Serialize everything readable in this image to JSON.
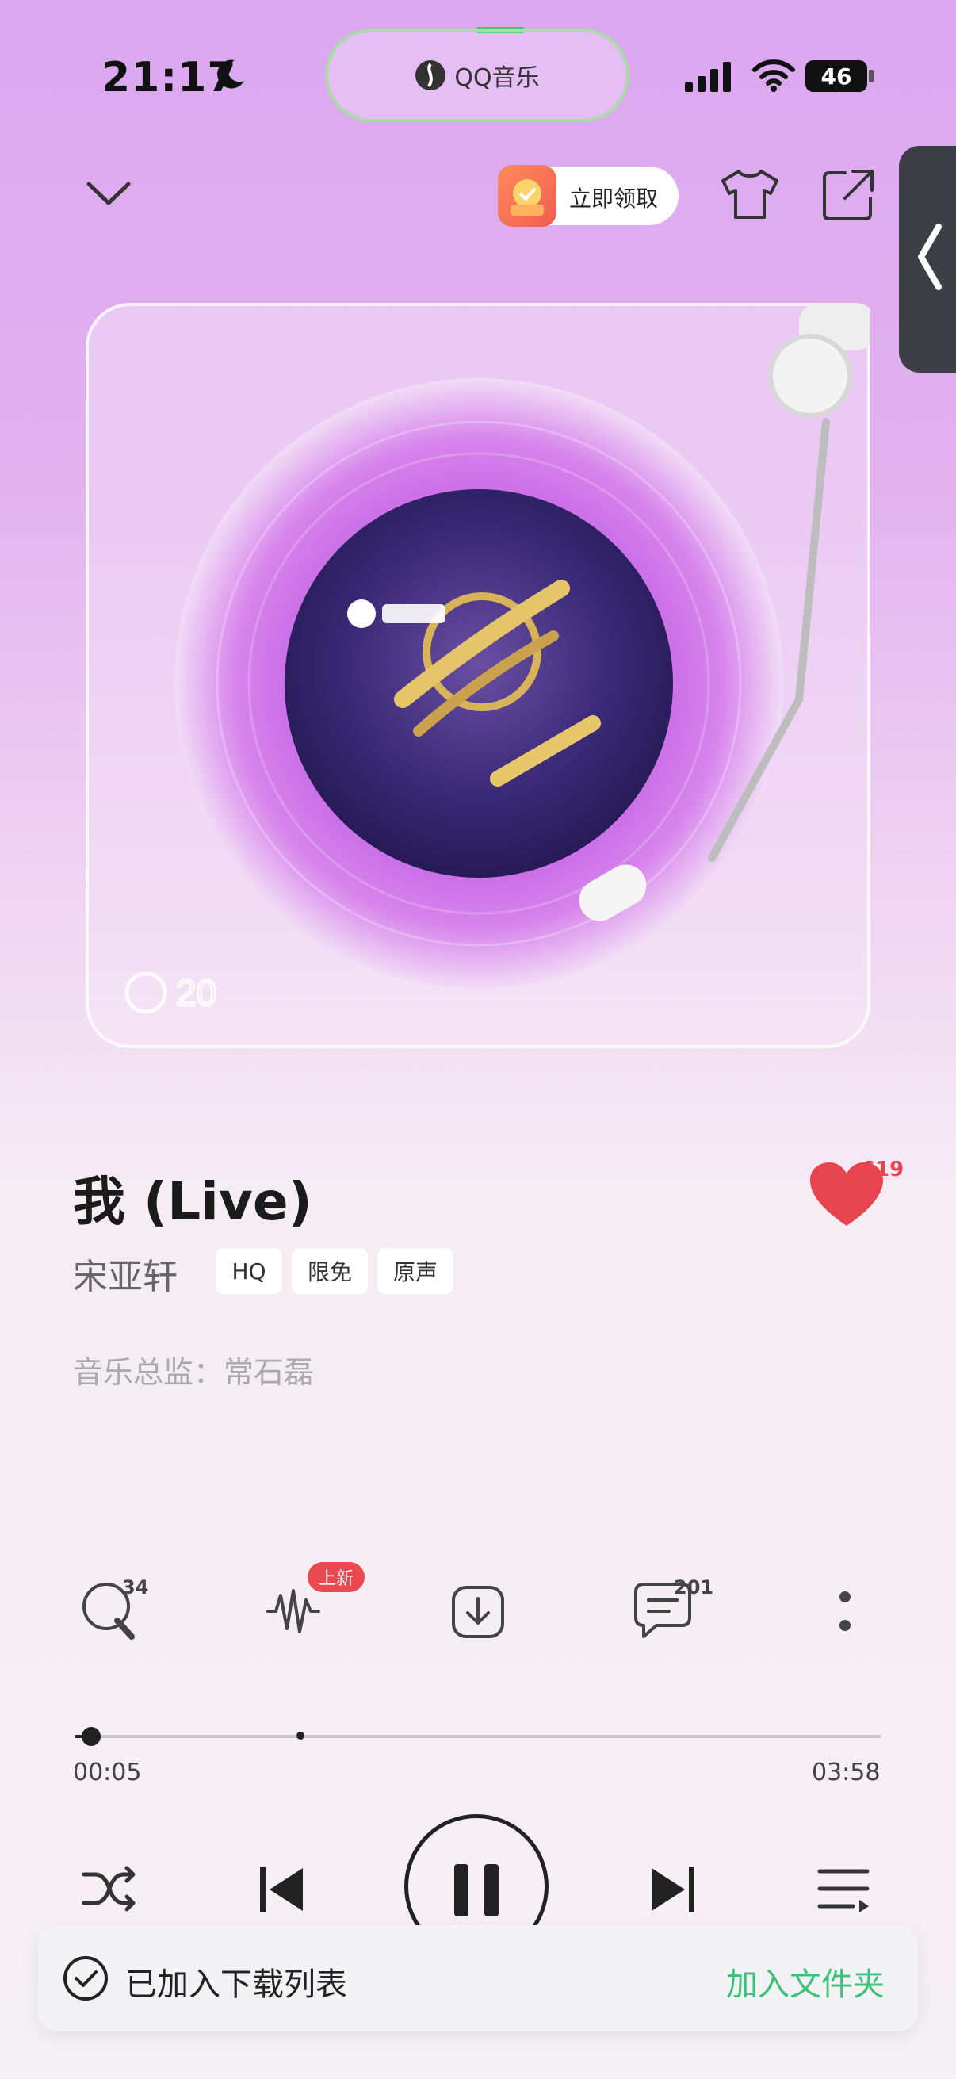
{
  "status": {
    "time": "21:17",
    "battery": "46",
    "island_label": "QQ音乐"
  },
  "header": {
    "promo_label": "立即领取"
  },
  "song": {
    "title": "我 (Live)",
    "artist": "宋亚轩",
    "tags": [
      "HQ",
      "限免",
      "原声"
    ],
    "credit": "音乐总监：常石磊",
    "likes": "619"
  },
  "actions": {
    "search_count": "34",
    "new_badge": "上新",
    "comment_count": "201"
  },
  "progress": {
    "current": "00:05",
    "total": "03:58",
    "played_fraction": 0.021,
    "buffered_fraction": 0.28
  },
  "toast": {
    "message": "已加入下载列表",
    "action": "加入文件夹"
  },
  "colors": {
    "accent_green": "#3cc27a",
    "like_red": "#e6454f",
    "vinyl_purple": "#c566e6"
  },
  "icons": [
    "chevron-down-icon",
    "tshirt-icon",
    "share-icon",
    "chevron-left-icon",
    "heart-icon",
    "search-music-icon",
    "waveform-icon",
    "download-icon",
    "comment-icon",
    "more-icon",
    "shuffle-icon",
    "previous-icon",
    "pause-icon",
    "next-icon",
    "playlist-icon",
    "check-circle-icon"
  ]
}
